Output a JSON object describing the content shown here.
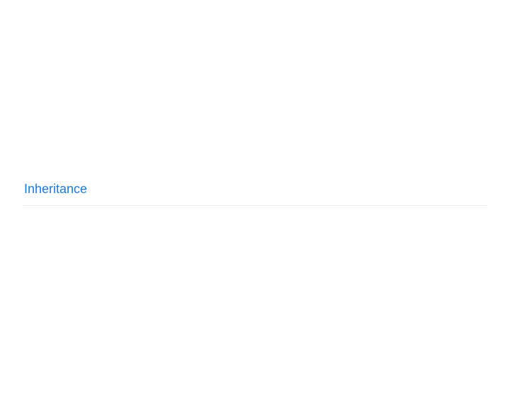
{
  "section": {
    "heading": "Inheritance"
  }
}
